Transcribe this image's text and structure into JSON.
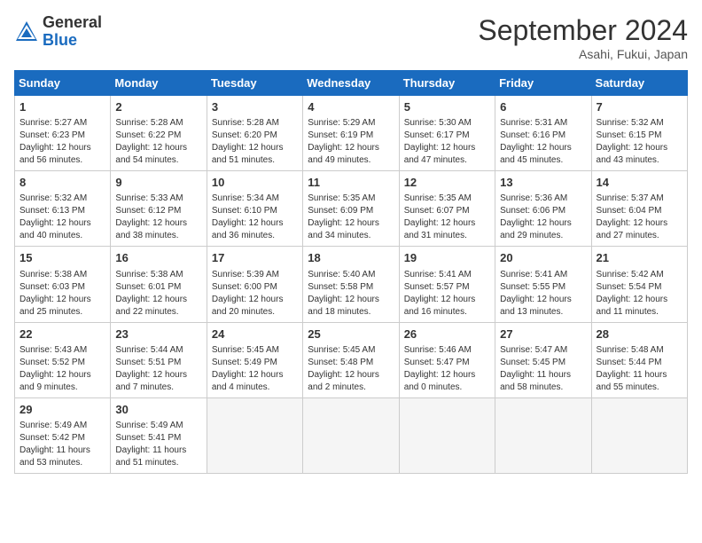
{
  "logo": {
    "general": "General",
    "blue": "Blue"
  },
  "title": "September 2024",
  "location": "Asahi, Fukui, Japan",
  "days_header": [
    "Sunday",
    "Monday",
    "Tuesday",
    "Wednesday",
    "Thursday",
    "Friday",
    "Saturday"
  ],
  "weeks": [
    [
      {
        "day": "1",
        "sunrise": "5:27 AM",
        "sunset": "6:23 PM",
        "daylight": "12 hours and 56 minutes."
      },
      {
        "day": "2",
        "sunrise": "5:28 AM",
        "sunset": "6:22 PM",
        "daylight": "12 hours and 54 minutes."
      },
      {
        "day": "3",
        "sunrise": "5:28 AM",
        "sunset": "6:20 PM",
        "daylight": "12 hours and 51 minutes."
      },
      {
        "day": "4",
        "sunrise": "5:29 AM",
        "sunset": "6:19 PM",
        "daylight": "12 hours and 49 minutes."
      },
      {
        "day": "5",
        "sunrise": "5:30 AM",
        "sunset": "6:17 PM",
        "daylight": "12 hours and 47 minutes."
      },
      {
        "day": "6",
        "sunrise": "5:31 AM",
        "sunset": "6:16 PM",
        "daylight": "12 hours and 45 minutes."
      },
      {
        "day": "7",
        "sunrise": "5:32 AM",
        "sunset": "6:15 PM",
        "daylight": "12 hours and 43 minutes."
      }
    ],
    [
      {
        "day": "8",
        "sunrise": "5:32 AM",
        "sunset": "6:13 PM",
        "daylight": "12 hours and 40 minutes."
      },
      {
        "day": "9",
        "sunrise": "5:33 AM",
        "sunset": "6:12 PM",
        "daylight": "12 hours and 38 minutes."
      },
      {
        "day": "10",
        "sunrise": "5:34 AM",
        "sunset": "6:10 PM",
        "daylight": "12 hours and 36 minutes."
      },
      {
        "day": "11",
        "sunrise": "5:35 AM",
        "sunset": "6:09 PM",
        "daylight": "12 hours and 34 minutes."
      },
      {
        "day": "12",
        "sunrise": "5:35 AM",
        "sunset": "6:07 PM",
        "daylight": "12 hours and 31 minutes."
      },
      {
        "day": "13",
        "sunrise": "5:36 AM",
        "sunset": "6:06 PM",
        "daylight": "12 hours and 29 minutes."
      },
      {
        "day": "14",
        "sunrise": "5:37 AM",
        "sunset": "6:04 PM",
        "daylight": "12 hours and 27 minutes."
      }
    ],
    [
      {
        "day": "15",
        "sunrise": "5:38 AM",
        "sunset": "6:03 PM",
        "daylight": "12 hours and 25 minutes."
      },
      {
        "day": "16",
        "sunrise": "5:38 AM",
        "sunset": "6:01 PM",
        "daylight": "12 hours and 22 minutes."
      },
      {
        "day": "17",
        "sunrise": "5:39 AM",
        "sunset": "6:00 PM",
        "daylight": "12 hours and 20 minutes."
      },
      {
        "day": "18",
        "sunrise": "5:40 AM",
        "sunset": "5:58 PM",
        "daylight": "12 hours and 18 minutes."
      },
      {
        "day": "19",
        "sunrise": "5:41 AM",
        "sunset": "5:57 PM",
        "daylight": "12 hours and 16 minutes."
      },
      {
        "day": "20",
        "sunrise": "5:41 AM",
        "sunset": "5:55 PM",
        "daylight": "12 hours and 13 minutes."
      },
      {
        "day": "21",
        "sunrise": "5:42 AM",
        "sunset": "5:54 PM",
        "daylight": "12 hours and 11 minutes."
      }
    ],
    [
      {
        "day": "22",
        "sunrise": "5:43 AM",
        "sunset": "5:52 PM",
        "daylight": "12 hours and 9 minutes."
      },
      {
        "day": "23",
        "sunrise": "5:44 AM",
        "sunset": "5:51 PM",
        "daylight": "12 hours and 7 minutes."
      },
      {
        "day": "24",
        "sunrise": "5:45 AM",
        "sunset": "5:49 PM",
        "daylight": "12 hours and 4 minutes."
      },
      {
        "day": "25",
        "sunrise": "5:45 AM",
        "sunset": "5:48 PM",
        "daylight": "12 hours and 2 minutes."
      },
      {
        "day": "26",
        "sunrise": "5:46 AM",
        "sunset": "5:47 PM",
        "daylight": "12 hours and 0 minutes."
      },
      {
        "day": "27",
        "sunrise": "5:47 AM",
        "sunset": "5:45 PM",
        "daylight": "11 hours and 58 minutes."
      },
      {
        "day": "28",
        "sunrise": "5:48 AM",
        "sunset": "5:44 PM",
        "daylight": "11 hours and 55 minutes."
      }
    ],
    [
      {
        "day": "29",
        "sunrise": "5:49 AM",
        "sunset": "5:42 PM",
        "daylight": "11 hours and 53 minutes."
      },
      {
        "day": "30",
        "sunrise": "5:49 AM",
        "sunset": "5:41 PM",
        "daylight": "11 hours and 51 minutes."
      },
      null,
      null,
      null,
      null,
      null
    ]
  ]
}
